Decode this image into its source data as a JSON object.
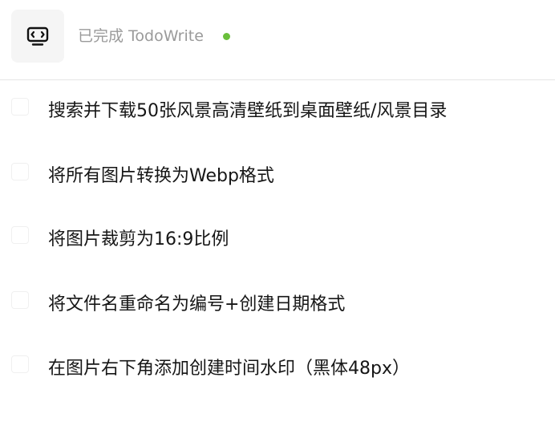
{
  "header": {
    "icon": "terminal-monitor-icon",
    "status_text": "已完成 TodoWrite",
    "status_color": "#6abf3b"
  },
  "todos": [
    {
      "label": "搜索并下载50张风景高清壁纸到桌面壁纸/风景目录",
      "checked": false
    },
    {
      "label": "将所有图片转换为Webp格式",
      "checked": false
    },
    {
      "label": "将图片裁剪为16:9比例",
      "checked": false
    },
    {
      "label": "将文件名重命名为编号+创建日期格式",
      "checked": false
    },
    {
      "label": "在图片右下角添加创建时间水印（黑体48px）",
      "checked": false
    }
  ]
}
